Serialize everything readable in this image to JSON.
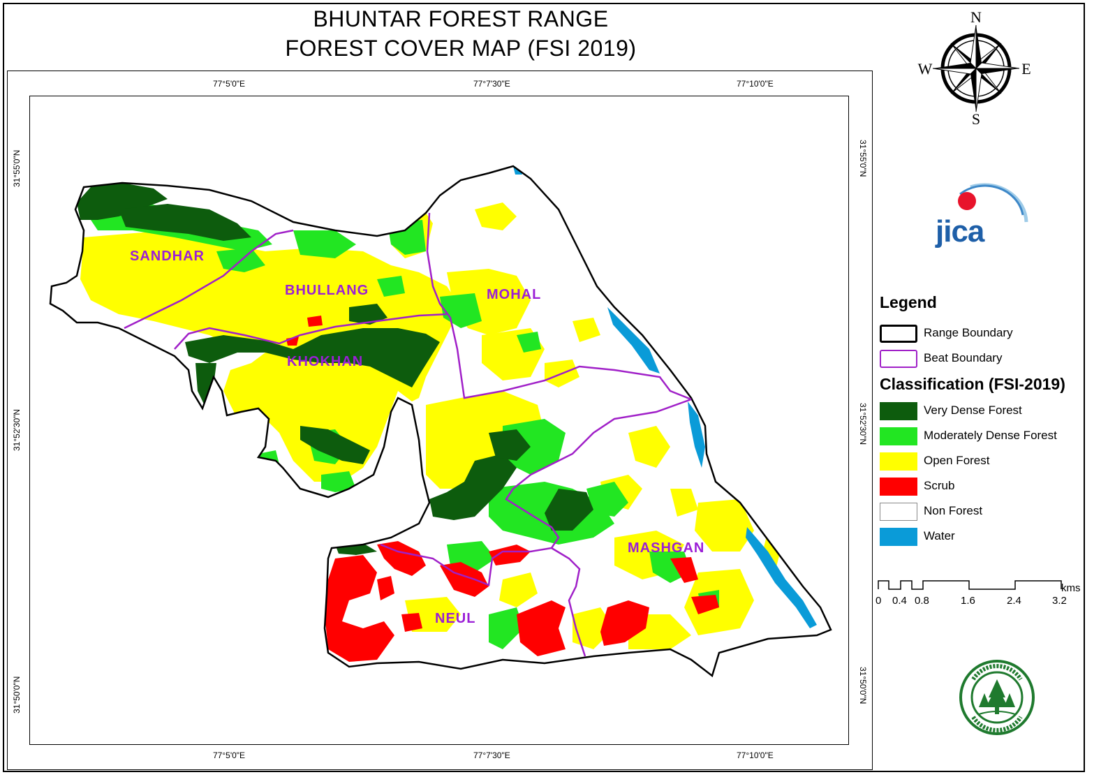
{
  "title": {
    "line1": "BHUNTAR FOREST RANGE",
    "line2": "FOREST COVER MAP (FSI 2019)"
  },
  "graticule": {
    "top": [
      "77°5'0\"E",
      "77°7'30\"E",
      "77°10'0\"E"
    ],
    "bottom": [
      "77°5'0\"E",
      "77°7'30\"E",
      "77°10'0\"E"
    ],
    "left": [
      "31°55'0\"N",
      "31°52'30\"N",
      "31°50'0\"N"
    ],
    "right": [
      "31°55'0\"N",
      "31°52'30\"N",
      "31°50'0\"N"
    ]
  },
  "beats": {
    "sandhar": "SANDHAR",
    "bhullang": "BHULLANG",
    "mohal": "MOHAL",
    "khokhan": "KHOKHAN",
    "mashgan": "MASHGAN",
    "neul": "NEUL"
  },
  "compass": {
    "n": "N",
    "s": "S",
    "e": "E",
    "w": "W"
  },
  "logo": {
    "jica": "JICA"
  },
  "legend": {
    "title": "Legend",
    "range_boundary": "Range Boundary",
    "beat_boundary": "Beat Boundary",
    "classification_title": "Classification (FSI-2019)",
    "classes": [
      {
        "label": "Very Dense Forest",
        "color": "#0d5c0d"
      },
      {
        "label": "Moderately Dense Forest",
        "color": "#22e622"
      },
      {
        "label": "Open Forest",
        "color": "#ffff00"
      },
      {
        "label": "Scrub",
        "color": "#ff0000"
      },
      {
        "label": "Non Forest",
        "color": "#ffffff"
      },
      {
        "label": "Water",
        "color": "#0a9bd8"
      }
    ],
    "range_color": "#000000",
    "beat_color": "#a020c8"
  },
  "scale": {
    "unit": "kms",
    "ticks": [
      "0",
      "0.4",
      "0.8",
      "1.6",
      "2.4",
      "3.2"
    ]
  }
}
